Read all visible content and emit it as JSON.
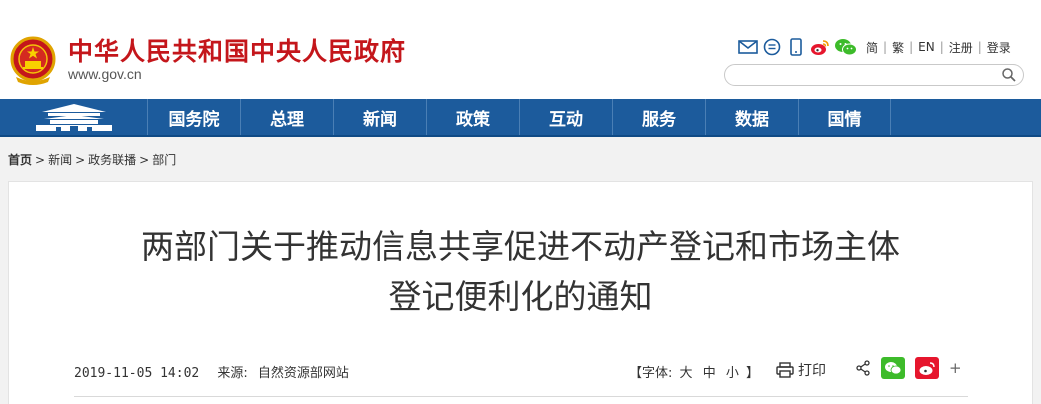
{
  "header": {
    "site_title": "中华人民共和国中央人民政府",
    "site_url": "www.gov.cn",
    "tools": {
      "icons": [
        "mail-icon",
        "message-icon",
        "mobile-icon",
        "weibo-icon",
        "wechat-icon"
      ],
      "lang_simplified": "简",
      "lang_traditional": "繁",
      "lang_english": "EN",
      "register": "注册",
      "login": "登录"
    },
    "search": {
      "placeholder": "",
      "value": ""
    }
  },
  "nav": {
    "home_icon": "tiananmen-icon",
    "items": [
      "国务院",
      "总理",
      "新闻",
      "政策",
      "互动",
      "服务",
      "数据",
      "国情"
    ]
  },
  "breadcrumb": {
    "items": [
      "首页",
      "新闻",
      "政务联播",
      "部门"
    ],
    "separator": ">"
  },
  "article": {
    "title_line1": "两部门关于推动信息共享促进不动产登记和市场主体",
    "title_line2": "登记便利化的通知",
    "date": "2019-11-05 14:02",
    "source_label": "来源:",
    "source": "自然资源部网站",
    "font_label": "【字体:",
    "font_large": "大",
    "font_medium": "中",
    "font_small": "小",
    "font_close": "】",
    "print_label": "打印",
    "share_plus": "+"
  },
  "colors": {
    "brand_red": "#c4161b",
    "nav_blue": "#1c5b9c",
    "wechat_green": "#3dbb2a",
    "weibo_red": "#e6162d"
  }
}
